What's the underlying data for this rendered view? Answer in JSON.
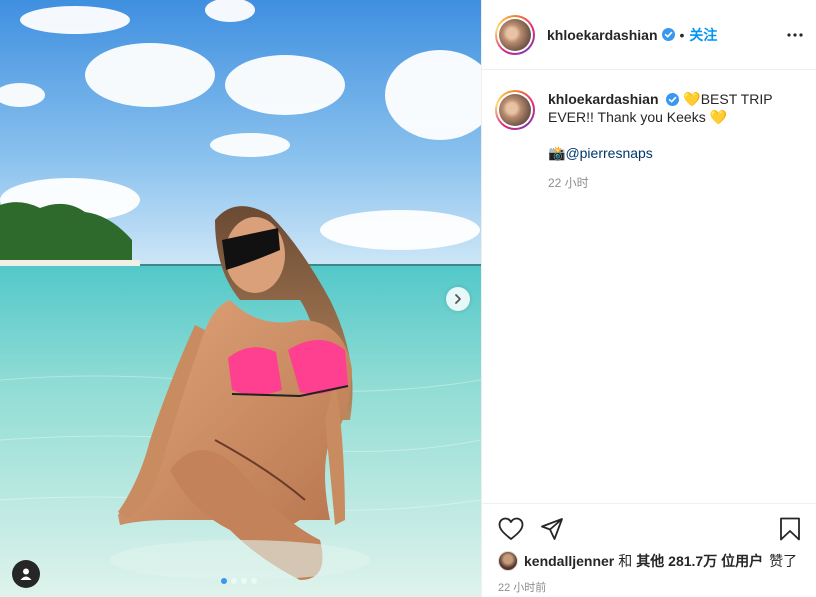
{
  "post": {
    "username": "khloekardashian",
    "separator": "•",
    "follow_label": "关注",
    "caption": {
      "text_part1": "BEST TRIP EVER!! Thank you Keeks",
      "emoji_heart": "💛",
      "camera_emoji": "📸",
      "mention": "@pierresnaps",
      "time": "22 小时"
    },
    "likes": {
      "liker": "kendalljenner",
      "connector": "和",
      "others": "其他 281.7万 位用户",
      "suffix": "赞了"
    },
    "posted_time": "22 小时前",
    "carousel": {
      "count": 4,
      "active_index": 0
    }
  },
  "colors": {
    "accent_blue": "#0095f6",
    "verified": "#3897f0",
    "text": "#262626",
    "muted": "#8e8e8e"
  },
  "icons": [
    "verified-badge-icon",
    "more-options-icon",
    "heart-icon",
    "share-icon",
    "save-bookmark-icon",
    "next-arrow-icon",
    "user-tag-icon"
  ]
}
